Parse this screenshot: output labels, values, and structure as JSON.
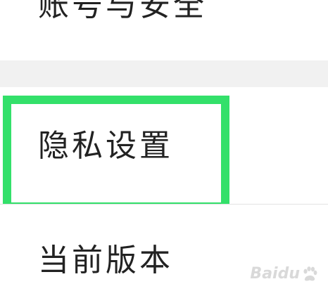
{
  "settings": {
    "items": [
      {
        "label": "账号与安全"
      },
      {
        "label": "隐私设置"
      },
      {
        "label": "当前版本"
      }
    ]
  },
  "watermark": {
    "text": "Baidu"
  },
  "colors": {
    "highlight": "#33e06a",
    "section_gap": "#f1f1f1",
    "text": "#222222"
  },
  "icons": {
    "watermark": "baidu-paw-icon"
  }
}
